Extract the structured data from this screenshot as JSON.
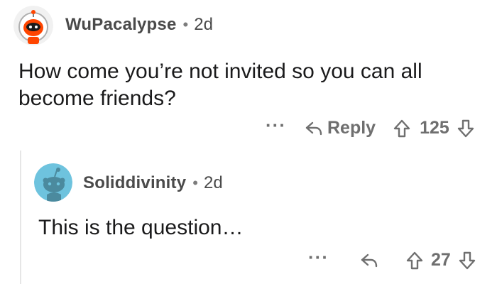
{
  "comments": [
    {
      "username": "WuPacalypse",
      "separator": "•",
      "age": "2d",
      "body_line1": "How come you’re not invited so you can all",
      "body_line2": "become friends?",
      "more_label": "···",
      "reply_label": "Reply",
      "score": "125",
      "avatar_icon": "orange-snoo-avatar-icon"
    },
    {
      "username": "Soliddivinity",
      "separator": "•",
      "age": "2d",
      "body_line1": "This is the question…",
      "more_label": "···",
      "score": "27",
      "avatar_icon": "default-snoo-avatar-icon"
    }
  ],
  "colors": {
    "text": "#1a1a1b",
    "meta": "#4a4a4a",
    "action": "#6f6f6f",
    "thread_line": "#e6e6e6",
    "avatar_orange": "#ff4500",
    "avatar_blue": "#6ec3de"
  }
}
